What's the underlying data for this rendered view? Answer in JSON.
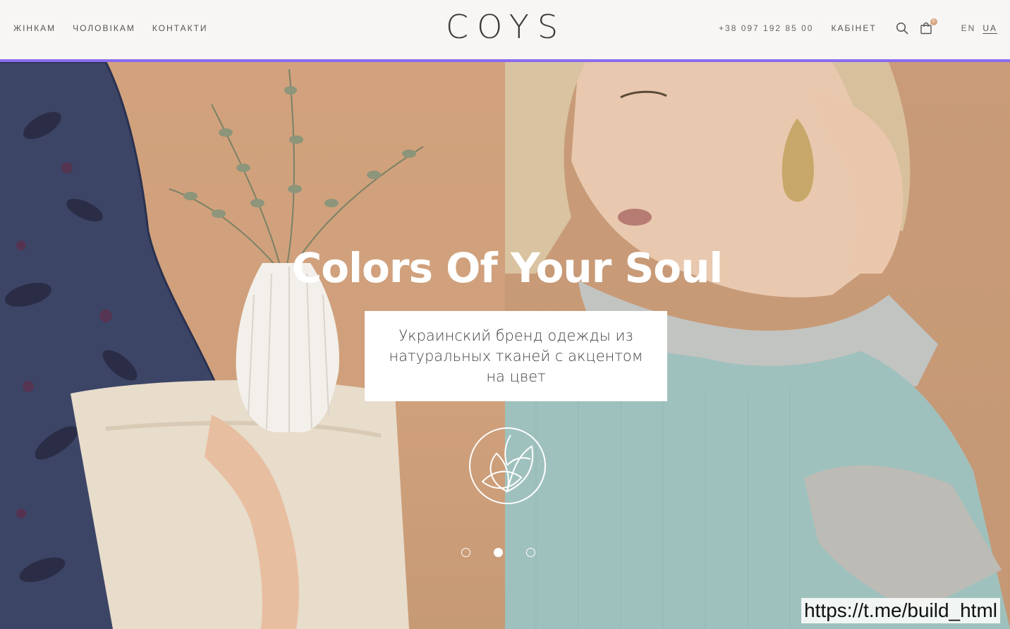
{
  "header": {
    "nav_left": [
      "ЖІНКАМ",
      "ЧОЛОВІКАМ",
      "КОНТАКТИ"
    ],
    "logo": "COYS",
    "phone": "+38 097 192 85 00",
    "cabinet": "КАБІНЕТ",
    "cart_count": "0",
    "languages": [
      "EN",
      "UA"
    ],
    "active_language": "UA",
    "icons": {
      "search": "search-icon",
      "cart": "shopping-bag-icon"
    }
  },
  "hero": {
    "headline": "Colors Of Your Soul",
    "tagline": "Украинский бренд одежды из натуральных тканей с акцентом на цвет",
    "emblem": "leaf-emblem-icon",
    "slides": {
      "count": 3,
      "active_index": 1
    }
  },
  "watermark": "https://t.me/build_html",
  "colors": {
    "accent_line": "#8a6cf0",
    "background_left": "#d1a27d",
    "header_bg": "#f7f6f4",
    "white": "#ffffff"
  }
}
